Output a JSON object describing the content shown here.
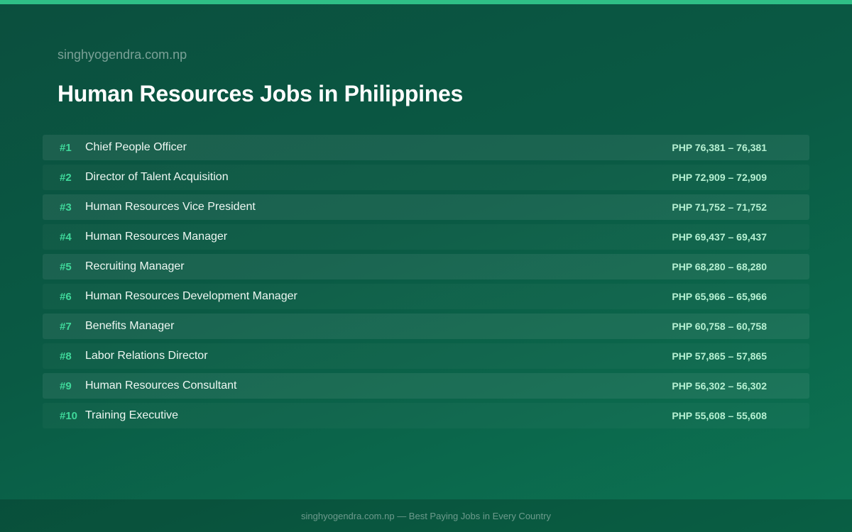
{
  "header": {
    "site_name": "singhyogendra.com.np",
    "title": "Human Resources Jobs in Philippines"
  },
  "jobs": [
    {
      "rank": "#1",
      "title": "Chief People Officer",
      "salary": "PHP 76,381 – 76,381"
    },
    {
      "rank": "#2",
      "title": "Director of Talent Acquisition",
      "salary": "PHP 72,909 – 72,909"
    },
    {
      "rank": "#3",
      "title": "Human Resources Vice President",
      "salary": "PHP 71,752 – 71,752"
    },
    {
      "rank": "#4",
      "title": "Human Resources Manager",
      "salary": "PHP 69,437 – 69,437"
    },
    {
      "rank": "#5",
      "title": "Recruiting Manager",
      "salary": "PHP 68,280 – 68,280"
    },
    {
      "rank": "#6",
      "title": "Human Resources Development Manager",
      "salary": "PHP 65,966 – 65,966"
    },
    {
      "rank": "#7",
      "title": "Benefits Manager",
      "salary": "PHP 60,758 – 60,758"
    },
    {
      "rank": "#8",
      "title": "Labor Relations Director",
      "salary": "PHP 57,865 – 57,865"
    },
    {
      "rank": "#9",
      "title": "Human Resources Consultant",
      "salary": "PHP 56,302 – 56,302"
    },
    {
      "rank": "#10",
      "title": "Training Executive",
      "salary": "PHP 55,608 – 55,608"
    }
  ],
  "footer": {
    "text": "singhyogendra.com.np — Best Paying Jobs in Every Country"
  },
  "colors": {
    "accent": "#2fbf86",
    "rank": "#3fd89a",
    "background": "#0a5a44"
  }
}
